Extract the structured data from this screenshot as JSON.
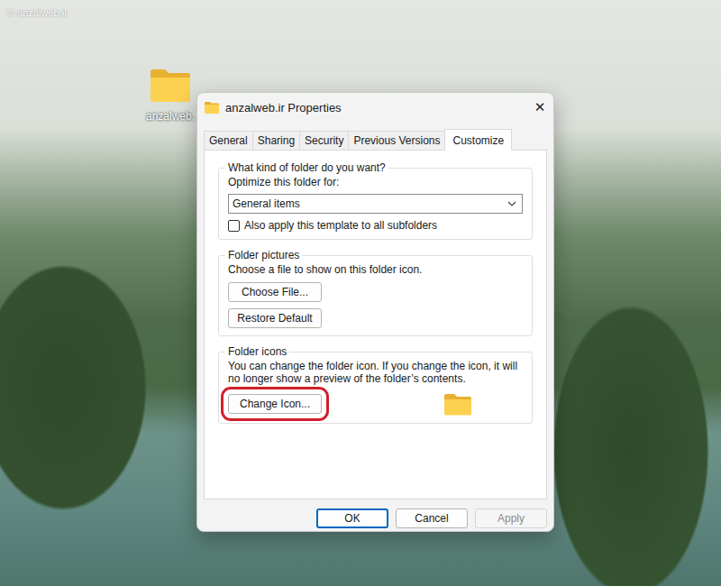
{
  "watermark": "© anzalweb.ir",
  "desktop_icons": [
    {
      "label": "anzalweb."
    }
  ],
  "window": {
    "title": "anzalweb.ir Properties",
    "close": "✕"
  },
  "tabs": [
    {
      "label": "General",
      "selected": false
    },
    {
      "label": "Sharing",
      "selected": false
    },
    {
      "label": "Security",
      "selected": false
    },
    {
      "label": "Previous Versions",
      "selected": false
    },
    {
      "label": "Customize",
      "selected": true
    }
  ],
  "template_group": {
    "title": "What kind of folder do you want?",
    "label": "Optimize this folder for:",
    "dropdown": {
      "value": "General items"
    },
    "checkbox": {
      "label": "Also apply this template to all subfolders",
      "checked": false
    }
  },
  "pictures_group": {
    "title": "Folder pictures",
    "text": "Choose a file to show on this folder icon.",
    "buttons": [
      {
        "label": "Choose File..."
      },
      {
        "label": "Restore Default"
      }
    ]
  },
  "icons_group": {
    "title": "Folder icons",
    "text": "You can change the folder icon. If you change the icon, it will no longer show a preview of the folder’s contents.",
    "button": {
      "label": "Change Icon...",
      "highlighted": true
    }
  },
  "footer_buttons": [
    {
      "label": "OK",
      "default": true,
      "disabled": false
    },
    {
      "label": "Cancel",
      "default": false,
      "disabled": false
    },
    {
      "label": "Apply",
      "default": false,
      "disabled": true
    }
  ]
}
